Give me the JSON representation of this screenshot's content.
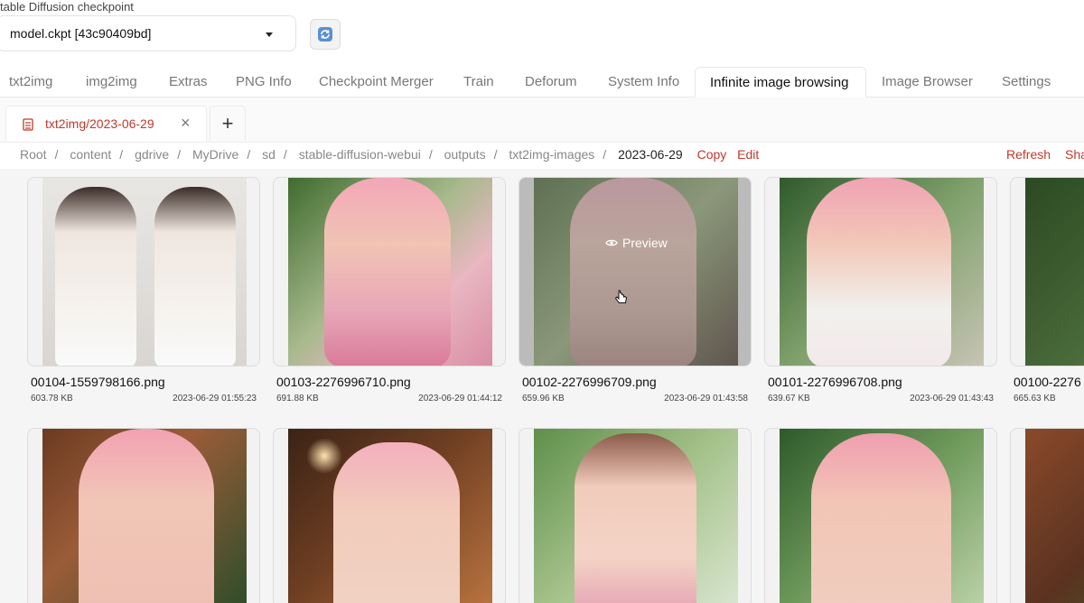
{
  "checkpoint": {
    "label": "table Diffusion checkpoint",
    "value": "model.ckpt [43c90409bd]"
  },
  "tabs": [
    {
      "label": "txt2img"
    },
    {
      "label": "img2img"
    },
    {
      "label": "Extras"
    },
    {
      "label": "PNG Info"
    },
    {
      "label": "Checkpoint Merger"
    },
    {
      "label": "Train"
    },
    {
      "label": "Deforum"
    },
    {
      "label": "System Info"
    },
    {
      "label": "Infinite image browsing",
      "active": true
    },
    {
      "label": "Image Browser"
    },
    {
      "label": "Settings"
    }
  ],
  "subtab": {
    "title": "txt2img/2023-06-29",
    "close": "×",
    "add": "+"
  },
  "breadcrumb": {
    "parts": [
      "Root",
      "content",
      "gdrive",
      "MyDrive",
      "sd",
      "stable-diffusion-webui",
      "outputs",
      "txt2img-images"
    ],
    "current": "2023-06-29",
    "copy": "Copy",
    "edit": "Edit"
  },
  "actions": {
    "refresh": "Refresh",
    "share": "Sha"
  },
  "preview_label": "Preview",
  "files": [
    {
      "name": "00104-1559798166.png",
      "size": "603.78 KB",
      "date": "2023-06-29 01:55:23"
    },
    {
      "name": "00103-2276996710.png",
      "size": "691.88 KB",
      "date": "2023-06-29 01:44:12"
    },
    {
      "name": "00102-2276996709.png",
      "size": "659.96 KB",
      "date": "2023-06-29 01:43:58"
    },
    {
      "name": "00101-2276996708.png",
      "size": "639.67 KB",
      "date": "2023-06-29 01:43:43"
    },
    {
      "name": "00100-2276",
      "size": "665.63 KB",
      "date": ""
    }
  ],
  "colors": {
    "accent": "#c0392b",
    "gallery_bg": "#f5f5f5"
  }
}
